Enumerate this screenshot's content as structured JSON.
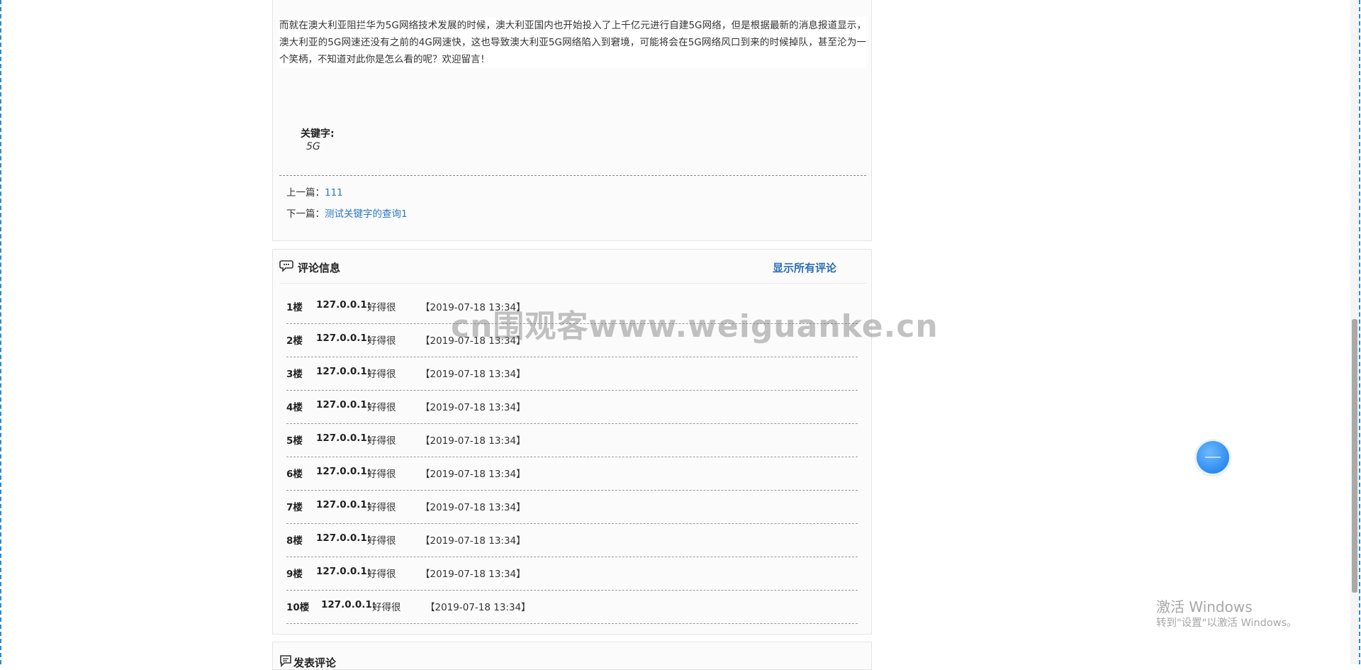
{
  "article": {
    "paragraph": "而就在澳大利亚阻拦华为5G网络技术发展的时候，澳大利亚国内也开始投入了上千亿元进行自建5G网络，但是根据最新的消息报道显示，澳大利亚的5G网速还没有之前的4G网速快，这也导致澳大利亚5G网络陷入到窘境，可能将会在5G网络风口到来的时候掉队，甚至沦为一个笑柄，不知道对此你是怎么看的呢？欢迎留言！",
    "keywords_label": "关键字:",
    "keywords_value": "5G",
    "prev_label": "上一篇：",
    "prev_link": "111",
    "next_label": "下一篇：",
    "next_link": "测试关键字的查询1"
  },
  "comments": {
    "title": "评论信息",
    "show_all": "显示所有评论",
    "items": [
      {
        "floor": "1楼",
        "ip": "127.0.0.1:",
        "text": "好得很",
        "time": "【2019-07-18 13:34】"
      },
      {
        "floor": "2楼",
        "ip": "127.0.0.1:",
        "text": "好得很",
        "time": "【2019-07-18 13:34】"
      },
      {
        "floor": "3楼",
        "ip": "127.0.0.1:",
        "text": "好得很",
        "time": "【2019-07-18 13:34】"
      },
      {
        "floor": "4楼",
        "ip": "127.0.0.1:",
        "text": "好得很",
        "time": "【2019-07-18 13:34】"
      },
      {
        "floor": "5楼",
        "ip": "127.0.0.1:",
        "text": "好得很",
        "time": "【2019-07-18 13:34】"
      },
      {
        "floor": "6楼",
        "ip": "127.0.0.1:",
        "text": "好得很",
        "time": "【2019-07-18 13:34】"
      },
      {
        "floor": "7楼",
        "ip": "127.0.0.1:",
        "text": "好得很",
        "time": "【2019-07-18 13:34】"
      },
      {
        "floor": "8楼",
        "ip": "127.0.0.1:",
        "text": "好得很",
        "time": "【2019-07-18 13:34】"
      },
      {
        "floor": "9楼",
        "ip": "127.0.0.1:",
        "text": "好得很",
        "time": "【2019-07-18 13:34】"
      },
      {
        "floor": "10楼",
        "ip": "127.0.0.1:",
        "text": "好得很",
        "time": "【2019-07-18 13:34】"
      }
    ]
  },
  "post_comment": {
    "title": "发表评论"
  },
  "watermark": "cn围观客www.weiguanke.cn",
  "windows_activation": {
    "title": "激活 Windows",
    "subtitle": "转到\"设置\"以激活 Windows。"
  },
  "icons": {
    "comment_icon": "chat-bubbles-icon",
    "post_icon": "speech-bubble-icon",
    "float_button": "float-circle-button"
  },
  "colors": {
    "link": "#2a78c2",
    "accent": "#2c8cf0",
    "border_dash": "#2a88d8"
  }
}
